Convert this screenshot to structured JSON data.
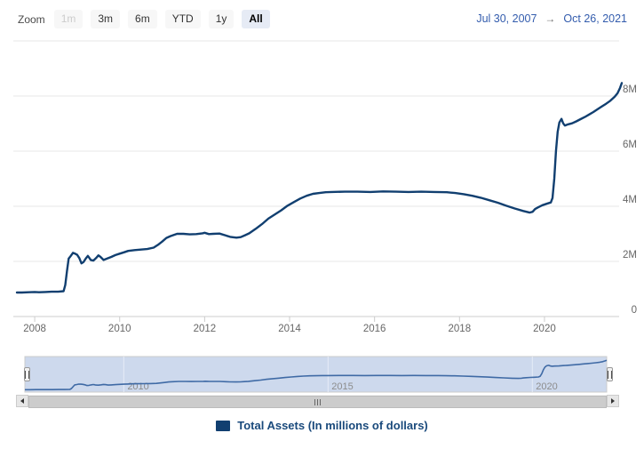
{
  "colors": {
    "series_line": "#113f70",
    "navigator_line": "#3f6aa5",
    "navigator_mask": "#cdd9ed",
    "navigator_outline": "#cccccc",
    "navigator_gridline": "#e6ecf7",
    "gridline": "#e7e7e7",
    "axis_line": "#cccccc",
    "axis_label": "#666666",
    "date_text": "#335cad",
    "selected_button_bg": "#e6ebf5",
    "legend_text": "#1a4a7c"
  },
  "range_selector": {
    "zoom_label": "Zoom",
    "buttons": [
      {
        "label": "1m",
        "state": "disabled"
      },
      {
        "label": "3m",
        "state": "normal"
      },
      {
        "label": "6m",
        "state": "normal"
      },
      {
        "label": "YTD",
        "state": "normal"
      },
      {
        "label": "1y",
        "state": "normal"
      },
      {
        "label": "All",
        "state": "selected"
      }
    ],
    "from_date": "Jul 30, 2007",
    "arrow": "→",
    "to_date": "Oct 26, 2021"
  },
  "chart_data": {
    "type": "line",
    "title": "",
    "xlabel": "",
    "ylabel": "",
    "x_range": [
      2007.58,
      2021.82
    ],
    "x_range_dates": [
      "Jul 30, 2007",
      "Oct 26, 2021"
    ],
    "y_range": [
      0,
      10
    ],
    "y_unit": "millions of dollars (axis ticks shown as M = millions)",
    "grid": true,
    "legend_position": "bottom-center",
    "x_ticks": [
      {
        "value": 2008,
        "label": "2008"
      },
      {
        "value": 2010,
        "label": "2010"
      },
      {
        "value": 2012,
        "label": "2012"
      },
      {
        "value": 2014,
        "label": "2014"
      },
      {
        "value": 2016,
        "label": "2016"
      },
      {
        "value": 2018,
        "label": "2018"
      },
      {
        "value": 2020,
        "label": "2020"
      }
    ],
    "y_ticks": [
      {
        "value": 0,
        "label": "0"
      },
      {
        "value": 2,
        "label": "2M"
      },
      {
        "value": 4,
        "label": "4M"
      },
      {
        "value": 6,
        "label": "6M"
      },
      {
        "value": 8,
        "label": "8M"
      },
      {
        "value": 10,
        "label": ""
      }
    ],
    "series": [
      {
        "name": "Total Assets (In millions of dollars)",
        "color": "#113f70",
        "points": [
          [
            2007.58,
            0.87
          ],
          [
            2007.7,
            0.87
          ],
          [
            2007.85,
            0.88
          ],
          [
            2008.0,
            0.89
          ],
          [
            2008.1,
            0.88
          ],
          [
            2008.25,
            0.89
          ],
          [
            2008.4,
            0.9
          ],
          [
            2008.55,
            0.9
          ],
          [
            2008.68,
            0.92
          ],
          [
            2008.72,
            1.15
          ],
          [
            2008.76,
            1.65
          ],
          [
            2008.8,
            2.1
          ],
          [
            2008.85,
            2.2
          ],
          [
            2008.9,
            2.31
          ],
          [
            2008.95,
            2.28
          ],
          [
            2009.0,
            2.24
          ],
          [
            2009.05,
            2.12
          ],
          [
            2009.1,
            1.93
          ],
          [
            2009.15,
            1.98
          ],
          [
            2009.2,
            2.1
          ],
          [
            2009.25,
            2.2
          ],
          [
            2009.28,
            2.14
          ],
          [
            2009.32,
            2.05
          ],
          [
            2009.38,
            2.03
          ],
          [
            2009.45,
            2.13
          ],
          [
            2009.5,
            2.22
          ],
          [
            2009.55,
            2.16
          ],
          [
            2009.62,
            2.05
          ],
          [
            2009.7,
            2.1
          ],
          [
            2009.8,
            2.16
          ],
          [
            2009.9,
            2.23
          ],
          [
            2010.0,
            2.28
          ],
          [
            2010.1,
            2.33
          ],
          [
            2010.2,
            2.38
          ],
          [
            2010.35,
            2.41
          ],
          [
            2010.5,
            2.43
          ],
          [
            2010.65,
            2.45
          ],
          [
            2010.8,
            2.5
          ],
          [
            2010.9,
            2.6
          ],
          [
            2011.0,
            2.72
          ],
          [
            2011.1,
            2.85
          ],
          [
            2011.2,
            2.92
          ],
          [
            2011.35,
            3.0
          ],
          [
            2011.5,
            3.0
          ],
          [
            2011.65,
            2.98
          ],
          [
            2011.8,
            2.99
          ],
          [
            2011.95,
            3.02
          ],
          [
            2012.0,
            3.04
          ],
          [
            2012.1,
            2.99
          ],
          [
            2012.2,
            3.0
          ],
          [
            2012.35,
            3.01
          ],
          [
            2012.5,
            2.94
          ],
          [
            2012.6,
            2.89
          ],
          [
            2012.75,
            2.86
          ],
          [
            2012.85,
            2.88
          ],
          [
            2012.95,
            2.95
          ],
          [
            2013.05,
            3.02
          ],
          [
            2013.2,
            3.18
          ],
          [
            2013.35,
            3.35
          ],
          [
            2013.5,
            3.55
          ],
          [
            2013.65,
            3.7
          ],
          [
            2013.8,
            3.85
          ],
          [
            2013.95,
            4.02
          ],
          [
            2014.1,
            4.15
          ],
          [
            2014.25,
            4.28
          ],
          [
            2014.4,
            4.38
          ],
          [
            2014.55,
            4.45
          ],
          [
            2014.7,
            4.48
          ],
          [
            2014.85,
            4.51
          ],
          [
            2015.0,
            4.52
          ],
          [
            2015.3,
            4.53
          ],
          [
            2015.6,
            4.53
          ],
          [
            2015.9,
            4.52
          ],
          [
            2016.2,
            4.54
          ],
          [
            2016.5,
            4.53
          ],
          [
            2016.8,
            4.52
          ],
          [
            2017.1,
            4.53
          ],
          [
            2017.4,
            4.52
          ],
          [
            2017.7,
            4.51
          ],
          [
            2017.9,
            4.48
          ],
          [
            2018.1,
            4.44
          ],
          [
            2018.3,
            4.38
          ],
          [
            2018.5,
            4.31
          ],
          [
            2018.7,
            4.22
          ],
          [
            2018.9,
            4.13
          ],
          [
            2019.1,
            4.02
          ],
          [
            2019.3,
            3.92
          ],
          [
            2019.5,
            3.83
          ],
          [
            2019.65,
            3.77
          ],
          [
            2019.72,
            3.8
          ],
          [
            2019.78,
            3.9
          ],
          [
            2019.85,
            3.96
          ],
          [
            2019.95,
            4.04
          ],
          [
            2020.05,
            4.09
          ],
          [
            2020.15,
            4.14
          ],
          [
            2020.19,
            4.3
          ],
          [
            2020.23,
            5.0
          ],
          [
            2020.27,
            6.0
          ],
          [
            2020.31,
            6.7
          ],
          [
            2020.35,
            7.04
          ],
          [
            2020.4,
            7.17
          ],
          [
            2020.44,
            7.01
          ],
          [
            2020.48,
            6.93
          ],
          [
            2020.55,
            6.97
          ],
          [
            2020.65,
            7.01
          ],
          [
            2020.75,
            7.08
          ],
          [
            2020.85,
            7.16
          ],
          [
            2020.95,
            7.24
          ],
          [
            2021.05,
            7.33
          ],
          [
            2021.15,
            7.42
          ],
          [
            2021.25,
            7.52
          ],
          [
            2021.35,
            7.62
          ],
          [
            2021.45,
            7.72
          ],
          [
            2021.55,
            7.83
          ],
          [
            2021.65,
            7.97
          ],
          [
            2021.72,
            8.1
          ],
          [
            2021.78,
            8.3
          ],
          [
            2021.82,
            8.47
          ]
        ]
      }
    ]
  },
  "navigator": {
    "labels": [
      {
        "value": 2010,
        "label": "2010"
      },
      {
        "value": 2015,
        "label": "2015"
      },
      {
        "value": 2020,
        "label": "2020"
      }
    ]
  },
  "legend": {
    "label": "Total Assets (In millions of dollars)"
  }
}
